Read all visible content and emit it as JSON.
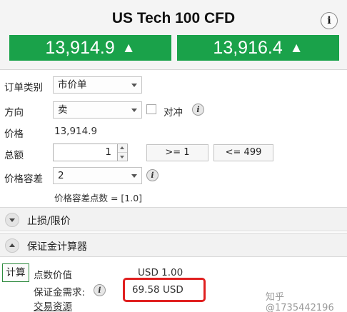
{
  "header": {
    "title": "US Tech 100 CFD",
    "info_label": "i",
    "sell_price": "13,914.9",
    "buy_price": "13,916.4",
    "arrow": "▲"
  },
  "form": {
    "order_type": {
      "label": "订单类别",
      "value": "市价单"
    },
    "direction": {
      "label": "方向",
      "value": "卖",
      "hedge_label": "对冲"
    },
    "price": {
      "label": "价格",
      "value": "13,914.9"
    },
    "amount": {
      "label": "总额",
      "value": "1",
      "min_label": ">= 1",
      "max_label": "<= 499"
    },
    "tolerance": {
      "label": "价格容差",
      "value": "2",
      "points_text": "价格容差点数 = [1.0]"
    },
    "info_glyph": "i"
  },
  "sections": {
    "stop_limit": {
      "label": "止损/限价",
      "state": "collapsed"
    },
    "margin_calc": {
      "label": "保证金计算器",
      "state": "expanded"
    }
  },
  "calculator": {
    "calc_button": "计算",
    "pip_value_label": "点数价值",
    "pip_value": "USD 1.00",
    "margin_label": "保证金需求:",
    "margin_value": "69.58 USD",
    "trading_resources": "交易资源"
  },
  "watermark": "知乎 @1735442196",
  "colors": {
    "price_green": "#1aa24a",
    "highlight_red": "#e02020",
    "calc_border": "#2e8b3e"
  }
}
